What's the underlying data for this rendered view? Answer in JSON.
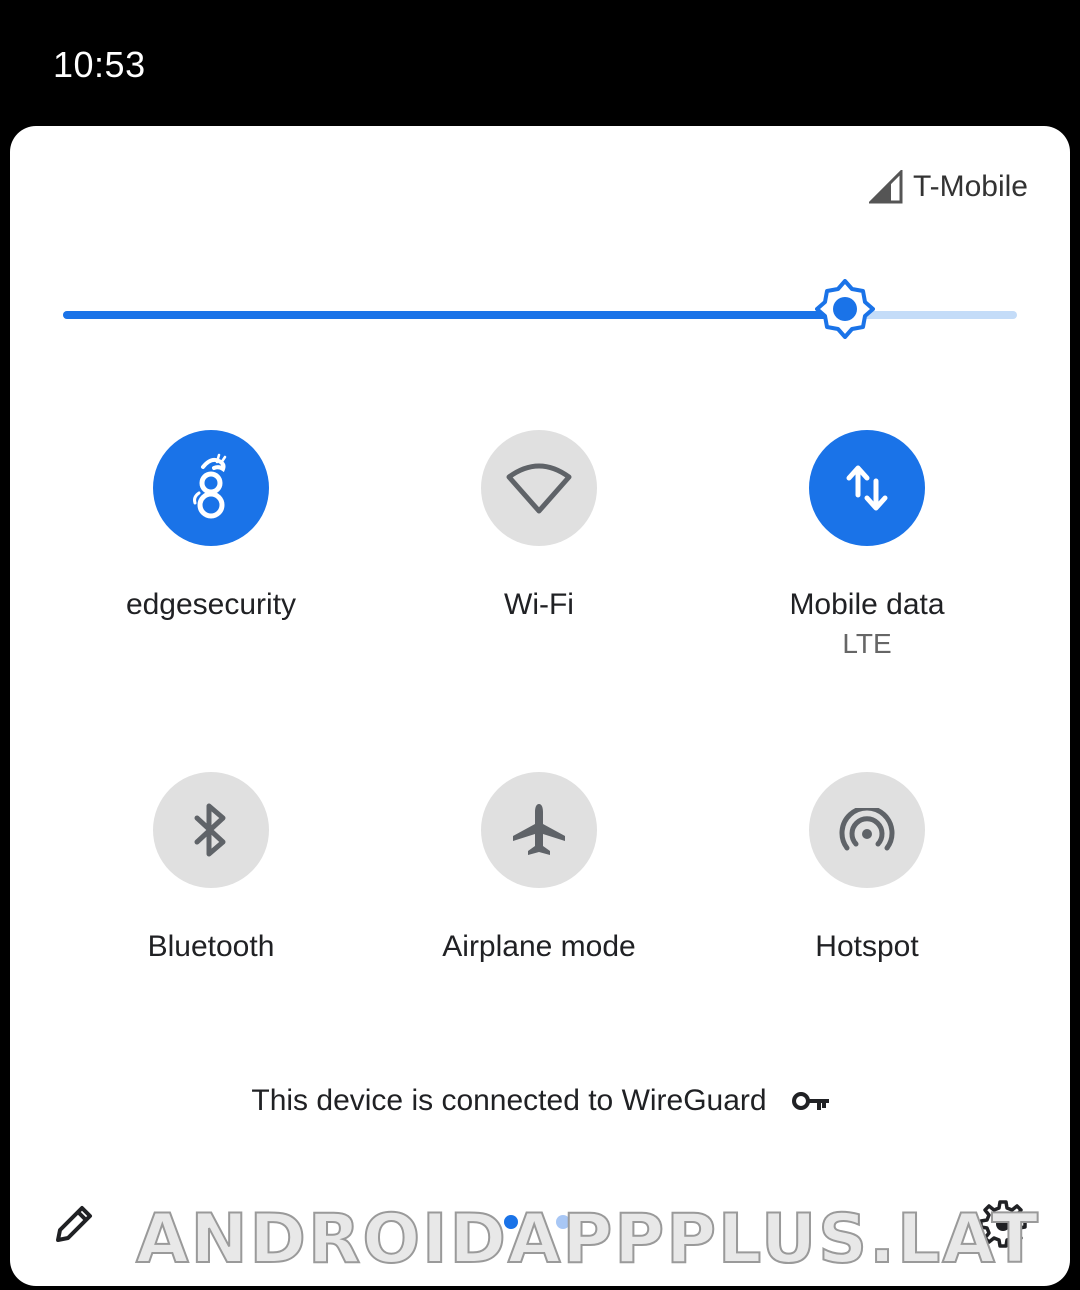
{
  "status_bar": {
    "time": "10:53"
  },
  "carrier": {
    "name": "T-Mobile",
    "icon": "signal-icon"
  },
  "brightness": {
    "level": 0.82,
    "icon": "brightness-icon",
    "accent": "#1a73e8"
  },
  "tiles": [
    {
      "label": "edgesecurity",
      "sublabel": "",
      "state": "on",
      "icon": "wireguard-dragon-icon"
    },
    {
      "label": "Wi-Fi",
      "sublabel": "",
      "state": "off",
      "icon": "wifi-icon"
    },
    {
      "label": "Mobile data",
      "sublabel": "LTE",
      "state": "on",
      "icon": "mobile-data-icon"
    },
    {
      "label": "Bluetooth",
      "sublabel": "",
      "state": "off",
      "icon": "bluetooth-icon"
    },
    {
      "label": "Airplane mode",
      "sublabel": "",
      "state": "off",
      "icon": "airplane-icon"
    },
    {
      "label": "Hotspot",
      "sublabel": "",
      "state": "off",
      "icon": "hotspot-icon"
    }
  ],
  "vpn_footer": {
    "text": "This device is connected to WireGuard",
    "icon": "key-icon"
  },
  "footer": {
    "edit_icon": "pencil-icon",
    "settings_icon": "gear-icon",
    "page_count": 2,
    "active_page": 1
  },
  "watermark": "ANDROIDAPPPLUS.LAT",
  "colors": {
    "active": "#1a73e8",
    "inactive_bg": "#e0e0e0",
    "inactive_icon": "#5f6368"
  }
}
